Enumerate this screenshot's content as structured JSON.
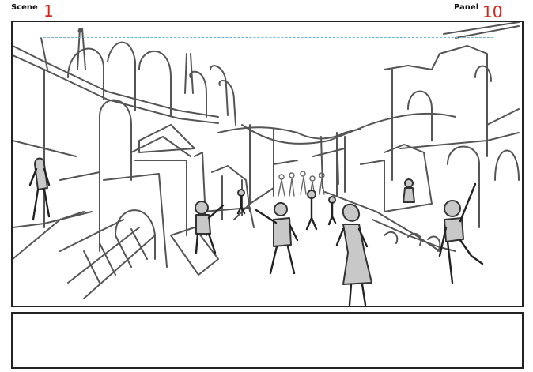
{
  "header": {
    "scene_label": "Scene",
    "scene_number": "1",
    "panel_label": "Panel",
    "panel_number": "10"
  },
  "panel": {
    "sketch_icon": "bazaar-street-sketch",
    "notes_text": ""
  }
}
